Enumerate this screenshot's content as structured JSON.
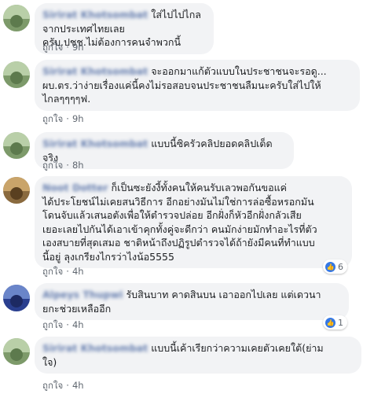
{
  "comments": [
    {
      "author": "Sirirat Khotsombat",
      "lines": [
        "ใส่ไปไปไกลจากประเทศไทยเลย",
        "ครับ.ปชช.ไม่ต้องการคนจำพวกนี้"
      ],
      "like_label": "ถูกใจ",
      "time": "9h"
    },
    {
      "author": "Sirirat Khotsombat",
      "lines": [
        "จะออกมาแก้ตัวแบบในประชาชนจะรอดู...",
        "ผบ.ตร.ว่าง่ายเรื่องแค่นี้คงไม่รอสอบจนประชาชนลืมนะครับใส่ไปให้",
        "ไกลๆๆๆๆฟ."
      ],
      "like_label": "ถูกใจ",
      "time": "9h"
    },
    {
      "author": "Sirirat Khotsombat",
      "lines": [
        "แบบนี้ซิครัวคลิปยอดคลิปเด็ดจริง"
      ],
      "like_label": "ถูกใจ",
      "time": "8h"
    },
    {
      "author": "Noot Dotter",
      "lines": [
        "ก็เป็นซะยังงี้ทั้งคนให้คนรับเลวพอกันขอแค่",
        "ได้ประโยชน์ไม่เคยสนวิธีการ อีกอย่างมันไม่ใช่การล่อซื้อหรอกมัน",
        "โดนจับแล้วเสนอตังเพื่อให้ตำรวจปล่อย อีกฝั่งก็หัวอีกฝั่งกลัวเสีย",
        "เยอะเลยไปกันได้เอาเข้าคุกทั้งคู่จะดีกว่า คนมักง่ายมักทำอะไรที่ตัว",
        "เองสบายที่สุดเสมอ ชาติหน้าถึงปฏิรูปตำรวจได้ถ้ายังมีคนที่ทำแบบ",
        "นี้อยู่ ลุงเกรียงไกรว่าไงน้อ5555"
      ],
      "like_label": "ถูกใจ",
      "time": "4h",
      "reactions": "6"
    },
    {
      "author": "Alpeys Thupwi",
      "lines": [
        "รับสินบาท คาดสินบน เอาออกไปเลย แต่เดวนา",
        "ยกะช่วยเหลืออีก"
      ],
      "like_label": "ถูกใจ",
      "time": "4h",
      "reactions": "1"
    },
    {
      "author": "Sirirat Khotsombat",
      "lines": [
        "แบบนี้เค้าเรียกว่าความเคยตัวเคยใต้(ย่าม",
        "ใจ)"
      ],
      "like_label": "ถูกใจ",
      "time": "4h"
    }
  ]
}
